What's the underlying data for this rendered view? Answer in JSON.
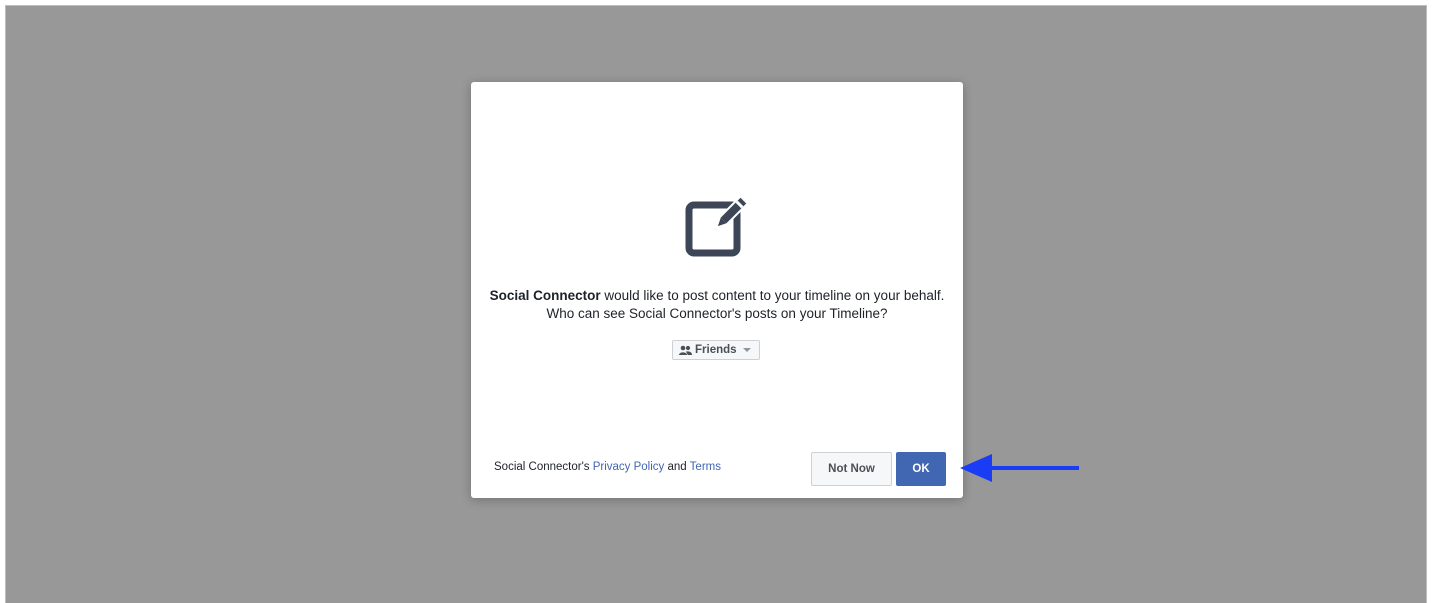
{
  "dialog": {
    "app_name": "Social Connector",
    "message_line1_suffix": " would like to post content to your timeline on your behalf.",
    "message_line2": "Who can see Social Connector's posts on your Timeline?",
    "audience": {
      "selected": "Friends",
      "icon": "friends-icon"
    },
    "footer": {
      "prefix": "Social Connector's ",
      "privacy_link": "Privacy Policy",
      "and": " and ",
      "terms_link": "Terms"
    },
    "buttons": {
      "not_now": "Not Now",
      "ok": "OK"
    },
    "icon": "edit-post-icon"
  },
  "annotation": {
    "icon": "arrow-left-icon",
    "color": "#1a3cf5"
  },
  "colors": {
    "overlay": "#989898",
    "primary": "#4267b2",
    "link": "#4267b2"
  }
}
